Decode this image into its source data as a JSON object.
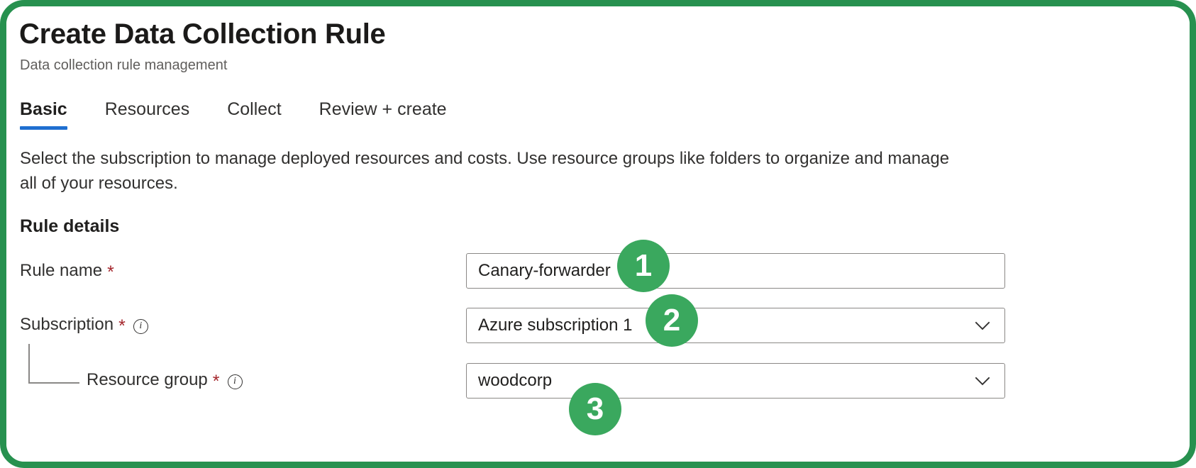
{
  "page": {
    "title": "Create Data Collection Rule",
    "subtitle": "Data collection rule management"
  },
  "tabs": [
    {
      "label": "Basic",
      "active": true
    },
    {
      "label": "Resources",
      "active": false
    },
    {
      "label": "Collect",
      "active": false
    },
    {
      "label": "Review + create",
      "active": false
    }
  ],
  "description": "Select the subscription to manage deployed resources and costs. Use resource groups like folders to organize and manage all of your resources.",
  "section": {
    "heading": "Rule details"
  },
  "fields": {
    "rule_name": {
      "label": "Rule name",
      "required_marker": "*",
      "value": "Canary-forwarder",
      "placeholder": ""
    },
    "subscription": {
      "label": "Subscription",
      "required_marker": "*",
      "info_glyph": "i",
      "value": "Azure subscription 1"
    },
    "resource_group": {
      "label": "Resource group",
      "required_marker": "*",
      "info_glyph": "i",
      "value": "woodcorp"
    }
  },
  "callouts": [
    {
      "number": "1"
    },
    {
      "number": "2"
    },
    {
      "number": "3"
    }
  ],
  "colors": {
    "frame_green": "#27914f",
    "badge_green": "#3aa85e",
    "tab_accent_blue": "#1f6fd0",
    "required_red": "#a4262c",
    "text_primary": "#323130",
    "text_secondary": "#605e5c",
    "border_grey": "#8a8886"
  }
}
